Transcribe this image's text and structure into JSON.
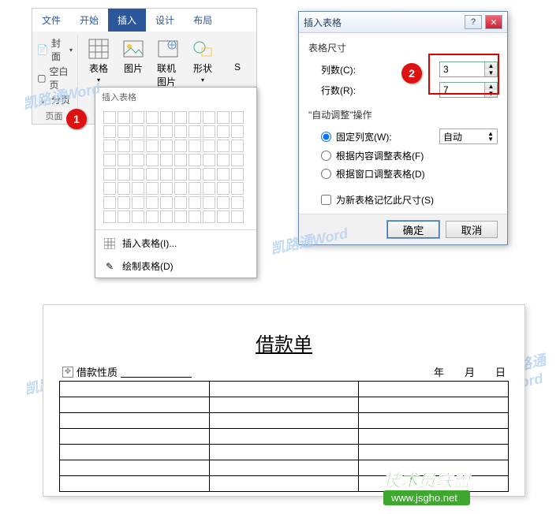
{
  "tabs": {
    "file": "文件",
    "home": "开始",
    "insert": "插入",
    "design": "设计",
    "layout": "布局"
  },
  "pages": {
    "cover": "封面",
    "blank": "空白页",
    "break": "分页",
    "group_label": "页面"
  },
  "buttons": {
    "table": "表格",
    "picture": "图片",
    "online_pic": "联机图片",
    "shapes": "形状",
    "s": "S"
  },
  "dropdown": {
    "header": "插入表格",
    "insert_table": "插入表格(I)...",
    "draw_table": "绘制表格(D)"
  },
  "dialog": {
    "title": "插入表格",
    "size_label": "表格尺寸",
    "cols_label": "列数(C):",
    "rows_label": "行数(R):",
    "cols_value": "3",
    "rows_value": "7",
    "autofit_label": "\"自动调整\"操作",
    "fixed_width": "固定列宽(W):",
    "fixed_width_value": "自动",
    "fit_content": "根据内容调整表格(F)",
    "fit_window": "根据窗口调整表格(D)",
    "remember": "为新表格记忆此尺寸(S)",
    "ok": "确定",
    "cancel": "取消",
    "help": "?"
  },
  "badges": {
    "one": "1",
    "two": "2"
  },
  "watermark": "凯路通Word",
  "doc": {
    "title": "借款单",
    "nature_label": "借款性质",
    "year": "年",
    "month": "月",
    "day": "日"
  },
  "footer": {
    "brand": "技术员联盟",
    "url": "www.jsgho.net"
  }
}
